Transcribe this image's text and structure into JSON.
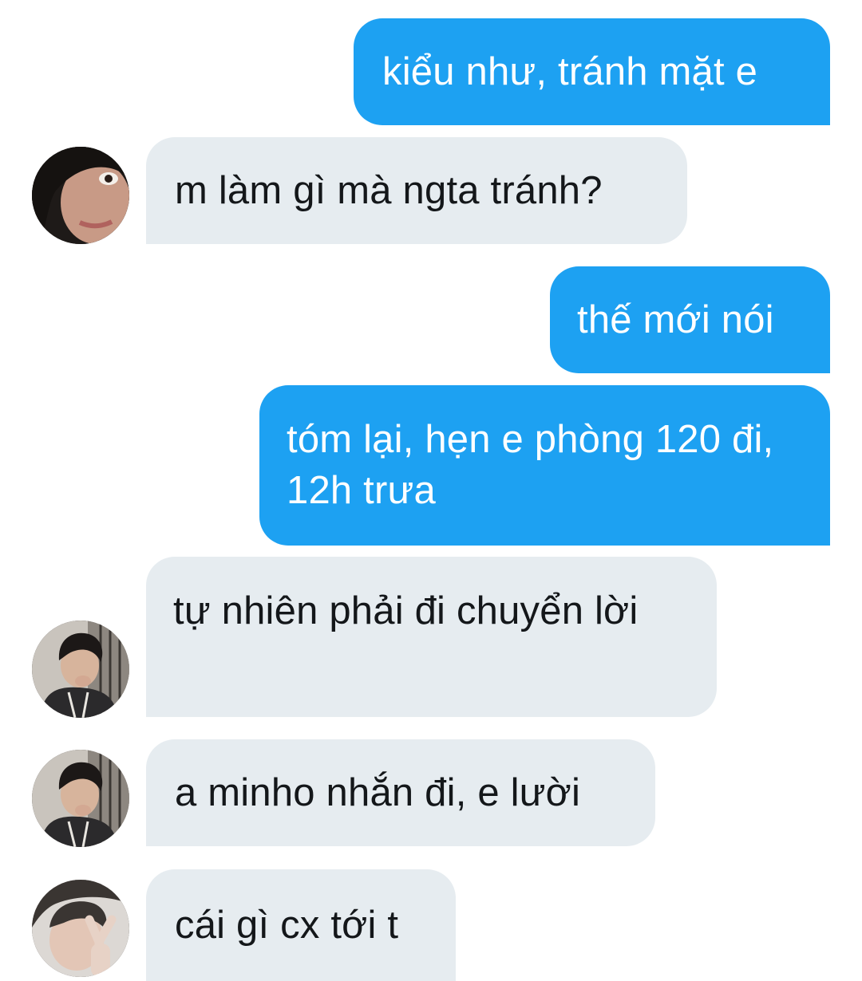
{
  "conversation": {
    "messages": [
      {
        "direction": "outgoing",
        "text": "kiểu như, tránh mặt e"
      },
      {
        "direction": "incoming",
        "text": "m làm gì mà ngta tránh?",
        "avatar": "dark-hood-avatar"
      },
      {
        "direction": "outgoing",
        "text": "thế mới nói"
      },
      {
        "direction": "outgoing",
        "text": "tóm lại, hẹn e phòng 120 đi, 12h trưa"
      },
      {
        "direction": "incoming",
        "text": "tự nhiên phải đi chuyển lời",
        "avatar": "dark-hair-avatar"
      },
      {
        "direction": "incoming",
        "text": "a minho nhắn đi, e lười",
        "avatar": "dark-hair-avatar"
      },
      {
        "direction": "incoming",
        "text": "cái gì cx tới t",
        "avatar": "peace-sign-avatar"
      }
    ]
  },
  "colors": {
    "outgoing_bubble": "#1da1f2",
    "incoming_bubble": "#e6ecf0",
    "outgoing_text": "#ffffff",
    "incoming_text": "#14171a"
  }
}
